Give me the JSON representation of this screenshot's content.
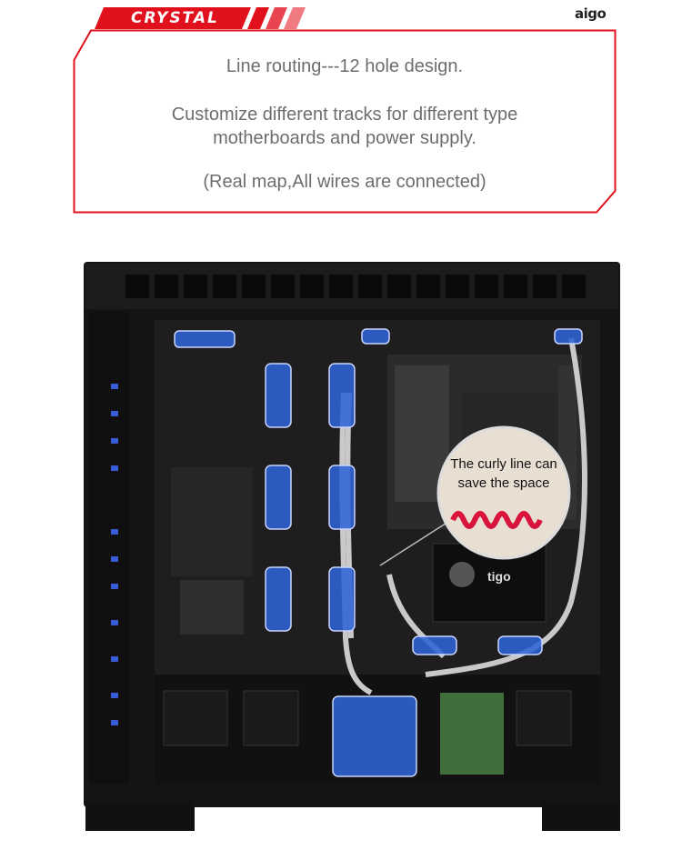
{
  "header": {
    "banner_title": "CRYSTAL",
    "brand_logo": "aigo"
  },
  "description": {
    "line_routing": "Line routing---12 hole design.",
    "customize_line1": "Customize different tracks for different type",
    "customize_line2": "motherboards and power supply.",
    "real_map_note": "(Real map,All wires are connected)"
  },
  "photo": {
    "callout_line1": "The curly line can",
    "callout_line2": "save the space",
    "ssd_label": "tigo"
  },
  "colors": {
    "accent_red": "#e0101c",
    "hole_highlight": "#2f63d6",
    "case_black": "#141414"
  },
  "icons": [
    "tiger-logo-icon",
    "curly-cable-icon"
  ]
}
